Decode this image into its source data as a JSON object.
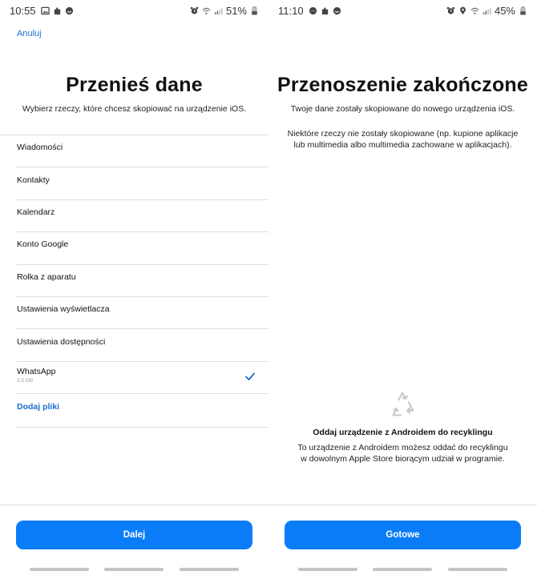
{
  "colors": {
    "accent": "#0a7cf7",
    "link": "#1a6fd0",
    "divider": "#dedede",
    "icon_gray": "#c8c8c8"
  },
  "left_screen": {
    "status_bar": {
      "time": "10:55",
      "left_icons": [
        "gallery-icon",
        "puzzle-icon",
        "face-icon"
      ],
      "right_icons": [
        "alarm-icon",
        "wifi-icon",
        "signal-icon"
      ],
      "battery": "51%"
    },
    "cancel_label": "Anuluj",
    "title": "Przenieś dane",
    "subtitle": "Wybierz rzeczy, które chcesz skopiować na urządzenie iOS.",
    "items": [
      {
        "label": "Wiadomości"
      },
      {
        "label": "Kontakty"
      },
      {
        "label": "Kalendarz"
      },
      {
        "label": "Konto Google"
      },
      {
        "label": "Rolka z aparatu"
      },
      {
        "label": "Ustawienia wyświetlacza"
      },
      {
        "label": "Ustawienia dostępności"
      },
      {
        "label": "WhatsApp",
        "sub": "3,5 GB",
        "checked": true
      }
    ],
    "add_files_label": "Dodaj pliki",
    "primary_button": "Dalej"
  },
  "right_screen": {
    "status_bar": {
      "time": "11:10",
      "left_icons": [
        "messenger-icon",
        "puzzle-icon",
        "face-icon"
      ],
      "right_icons": [
        "alarm-icon",
        "location-icon",
        "wifi-icon",
        "signal-icon"
      ],
      "battery": "45%"
    },
    "title": "Przenoszenie zakończone",
    "subtitle1": "Twoje dane zostały skopiowane do nowego urządzenia iOS.",
    "subtitle2_line1": "Niektóre rzeczy nie zostały skopiowane (np. kupione aplikacje",
    "subtitle2_line2": "lub multimedia albo multimedia zachowane w aplikacjach).",
    "recycle_title": "Oddaj urządzenie z Androidem do recyklingu",
    "recycle_desc_line1": "To urządzenie z Androidem możesz oddać do recyklingu",
    "recycle_desc_line2": "w dowolnym Apple Store biorącym udział w programie.",
    "primary_button": "Gotowe"
  }
}
